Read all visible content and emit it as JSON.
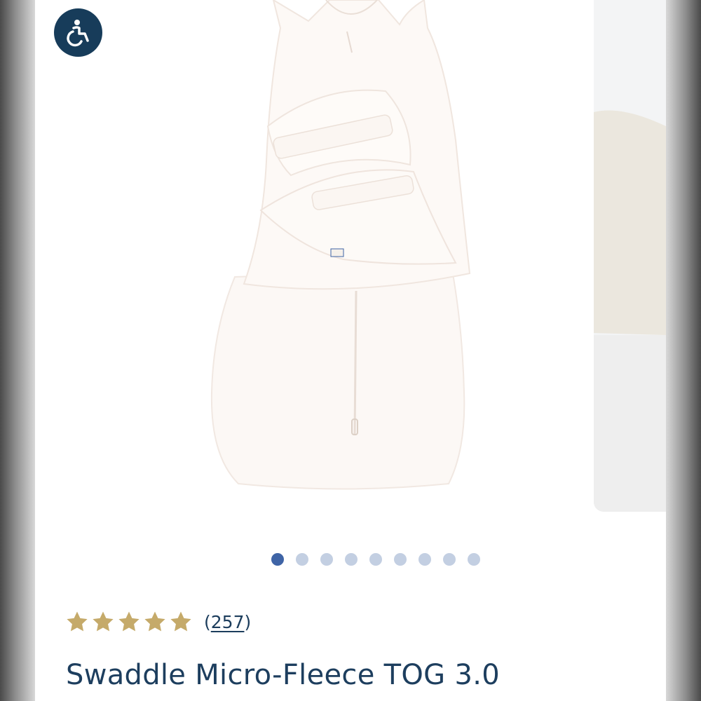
{
  "accessibility": {
    "icon": "accessibility-wheelchair-icon",
    "color": "#173c5a"
  },
  "carousel": {
    "total_slides": 9,
    "active_index": 0,
    "active_color": "#3f64a6",
    "inactive_color": "#c3cfe2"
  },
  "product": {
    "rating": {
      "stars": 5,
      "count": "257",
      "star_color": "#c5aa6a"
    },
    "title": "Swaddle Micro-Fleece TOG 3.0"
  }
}
